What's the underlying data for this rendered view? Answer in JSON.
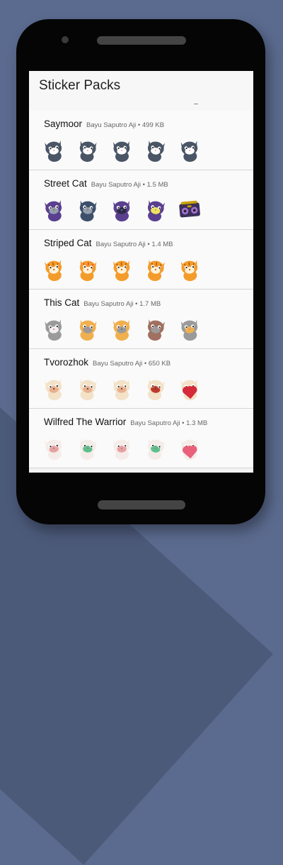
{
  "app": {
    "title": "Sticker Packs"
  },
  "packs": [
    {
      "name": "Saymoor",
      "publisher": "Bayu Saputro Aji",
      "size": "499 KB",
      "stickers": [
        {
          "icon": "husky-sticker",
          "body": "#4a5566",
          "accent": "#ffffff",
          "extra": "#f3a0b8"
        },
        {
          "icon": "husky-sticker",
          "body": "#4a5566",
          "accent": "#ffffff",
          "extra": "#f3a0b8"
        },
        {
          "icon": "husky-sticker",
          "body": "#4a5566",
          "accent": "#ffffff",
          "extra": "#f3a0b8"
        },
        {
          "icon": "husky-sticker",
          "body": "#4a5566",
          "accent": "#ffffff",
          "extra": "#f3a0b8"
        },
        {
          "icon": "husky-sticker",
          "body": "#4a5566",
          "accent": "#ffffff",
          "extra": "#f3a0b8"
        }
      ]
    },
    {
      "name": "Street Cat",
      "publisher": "Bayu Saputro Aji",
      "size": "1.5 MB",
      "stickers": [
        {
          "icon": "street-cat-sticker",
          "body": "#5b3f8f",
          "accent": "#8fa0b0",
          "extra": "#e74c3c"
        },
        {
          "icon": "street-cat-sticker",
          "body": "#3d4f6a",
          "accent": "#8fa0b0",
          "extra": "#e74c3c"
        },
        {
          "icon": "street-cat-sticker",
          "body": "#5b3f8f",
          "accent": "#2c2c44",
          "extra": "#7d6bb0"
        },
        {
          "icon": "street-cat-sticker",
          "body": "#5b3f8f",
          "accent": "#f1e35a",
          "extra": "#8fa0b0"
        },
        {
          "icon": "boombox-sticker",
          "body": "#3b2f5a",
          "accent": "#c8a000",
          "extra": "#a070d0"
        }
      ]
    },
    {
      "name": "Striped Cat",
      "publisher": "Bayu Saputro Aji",
      "size": "1.4 MB",
      "stickers": [
        {
          "icon": "striped-cat-sticker",
          "body": "#f39c2c",
          "accent": "#fff2d8",
          "extra": "#b35a00"
        },
        {
          "icon": "striped-cat-sticker",
          "body": "#f39c2c",
          "accent": "#fff2d8",
          "extra": "#e74c3c"
        },
        {
          "icon": "striped-cat-sticker",
          "body": "#f39c2c",
          "accent": "#fff2d8",
          "extra": "#b35a00"
        },
        {
          "icon": "striped-cat-sticker",
          "body": "#f39c2c",
          "accent": "#fff2d8",
          "extra": "#b35a00"
        },
        {
          "icon": "striped-cat-sticker",
          "body": "#f39c2c",
          "accent": "#fff2d8",
          "extra": "#b35a00"
        }
      ]
    },
    {
      "name": "This Cat",
      "publisher": "Bayu Saputro Aji",
      "size": "1.7 MB",
      "stickers": [
        {
          "icon": "this-cat-sticker",
          "body": "#9a9a9a",
          "accent": "#f0f0f0",
          "extra": "#e07a8a"
        },
        {
          "icon": "this-cat-sticker",
          "body": "#f0b050",
          "accent": "#9a9a9a",
          "extra": "#e07a8a"
        },
        {
          "icon": "this-cat-sticker",
          "body": "#f0b050",
          "accent": "#9a9a9a",
          "extra": "#6a6a8a"
        },
        {
          "icon": "this-cat-sticker",
          "body": "#a07060",
          "accent": "#9a9a9a",
          "extra": "#e07a8a"
        },
        {
          "icon": "this-cat-sticker",
          "body": "#9a9a9a",
          "accent": "#f0b050",
          "extra": "#e07a8a"
        }
      ]
    },
    {
      "name": "Tvorozhok",
      "publisher": "Bayu Saputro Aji",
      "size": "650 KB",
      "stickers": [
        {
          "icon": "tvorozhok-sticker",
          "body": "#f3e2c8",
          "accent": "#e8b090",
          "extra": "#5a3a2a"
        },
        {
          "icon": "tvorozhok-sticker",
          "body": "#f3e2c8",
          "accent": "#e8b090",
          "extra": "#5a3a2a"
        },
        {
          "icon": "tvorozhok-sticker",
          "body": "#f3e2c8",
          "accent": "#e8b090",
          "extra": "#5a3a2a"
        },
        {
          "icon": "tvorozhok-sticker",
          "body": "#f3e2c8",
          "accent": "#c0392b",
          "extra": "#5a3a2a"
        },
        {
          "icon": "tvorozhok-heart-sticker",
          "body": "#f3e2c8",
          "accent": "#d42a3a",
          "extra": "#5a3a2a"
        }
      ]
    },
    {
      "name": "Wilfred The Warrior",
      "publisher": "Bayu Saputro Aji",
      "size": "1.3 MB",
      "stickers": [
        {
          "icon": "wilfred-sticker",
          "body": "#f4ece8",
          "accent": "#e9a0a0",
          "extra": "#8a8a8a"
        },
        {
          "icon": "wilfred-sticker",
          "body": "#f4ece8",
          "accent": "#5fbf8a",
          "extra": "#8a8a8a"
        },
        {
          "icon": "wilfred-sticker",
          "body": "#f4ece8",
          "accent": "#e9a0a0",
          "extra": "#8a8a8a"
        },
        {
          "icon": "wilfred-sticker",
          "body": "#f4ece8",
          "accent": "#5fbf8a",
          "extra": "#8a8a8a"
        },
        {
          "icon": "wilfred-heart-sticker",
          "body": "#f4ece8",
          "accent": "#e9607a",
          "extra": "#8a8a8a"
        }
      ]
    }
  ]
}
